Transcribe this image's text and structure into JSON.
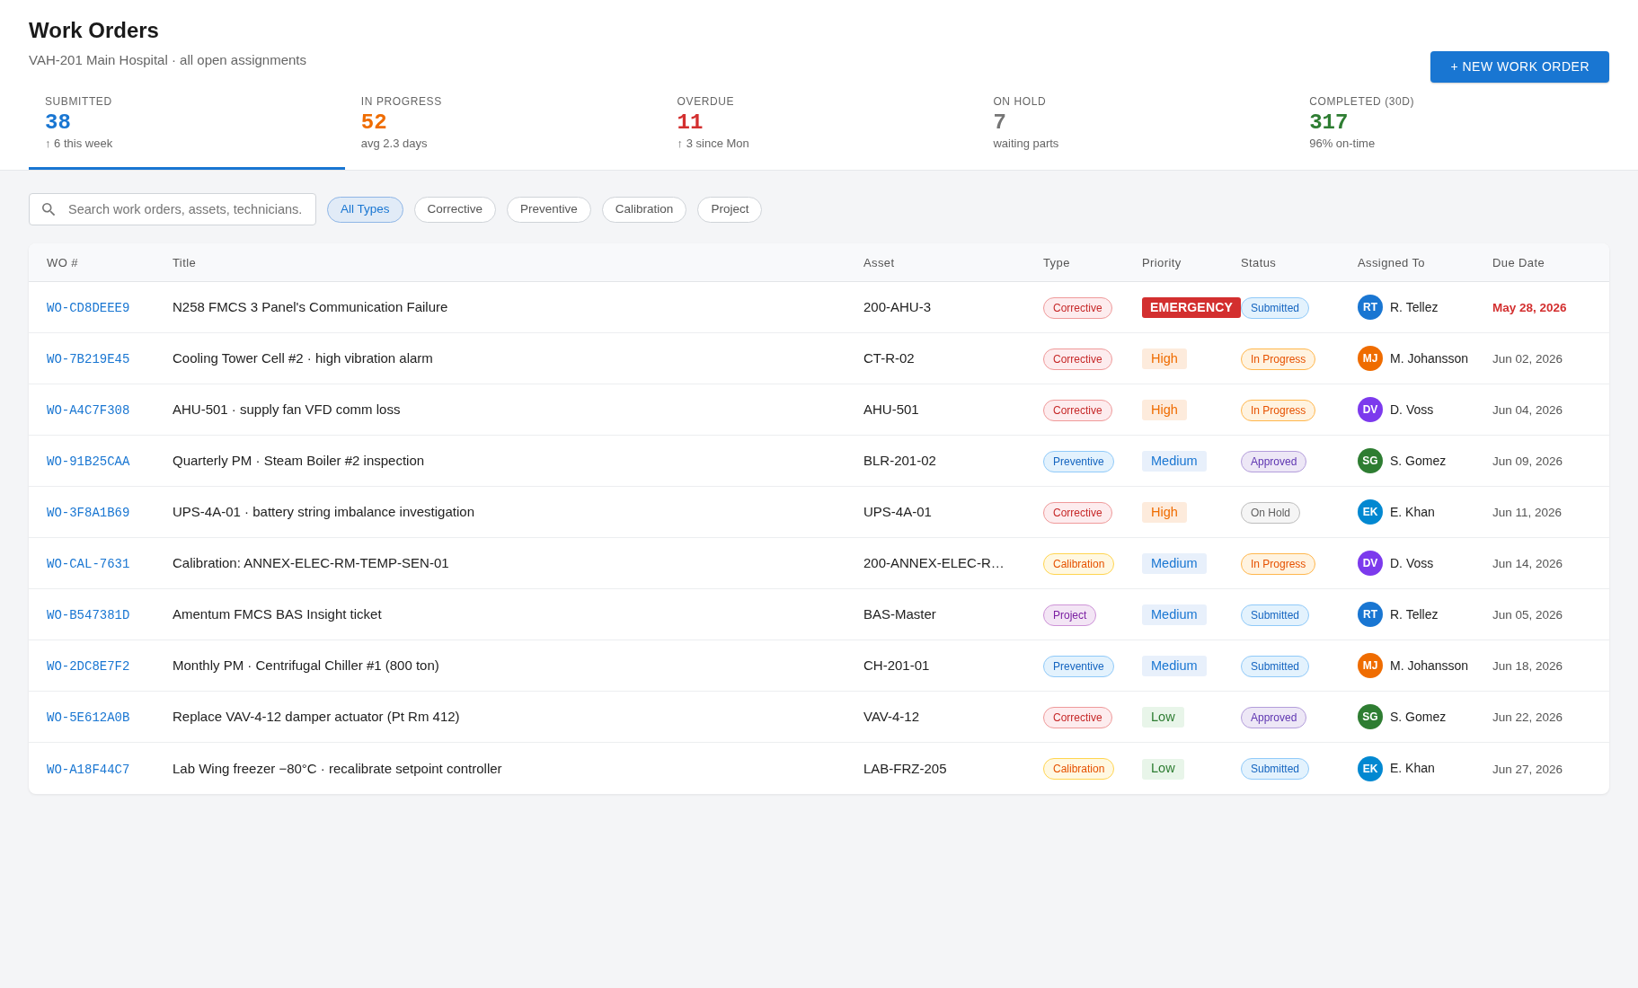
{
  "header": {
    "title": "Work Orders",
    "subtitle": "VAH-201 Main Hospital · all open assignments",
    "new_button": "+ NEW WORK ORDER"
  },
  "stats": [
    {
      "label": "SUBMITTED",
      "value": "38",
      "note": "↑ 6 this week",
      "color": "#1976d2",
      "selected": true
    },
    {
      "label": "IN PROGRESS",
      "value": "52",
      "note": "avg 2.3 days",
      "color": "#ef6c00",
      "selected": false
    },
    {
      "label": "OVERDUE",
      "value": "11",
      "note": "↑ 3 since Mon",
      "color": "#d32f2f",
      "selected": false
    },
    {
      "label": "ON HOLD",
      "value": "7",
      "note": "waiting parts",
      "color": "#757575",
      "selected": false
    },
    {
      "label": "COMPLETED (30D)",
      "value": "317",
      "note": "96% on-time",
      "color": "#2e7d32",
      "selected": false
    }
  ],
  "search": {
    "placeholder": "Search work orders, assets, technicians."
  },
  "type_filters": [
    {
      "label": "All Types",
      "selected": true
    },
    {
      "label": "Corrective",
      "selected": false
    },
    {
      "label": "Preventive",
      "selected": false
    },
    {
      "label": "Calibration",
      "selected": false
    },
    {
      "label": "Project",
      "selected": false
    }
  ],
  "table": {
    "columns": [
      "WO #",
      "Title",
      "Asset",
      "Type",
      "Priority",
      "Status",
      "Assigned To",
      "Due Date"
    ],
    "rows": [
      {
        "wo": "WO-CD8DEEE9",
        "title": "N258 FMCS 3 Panel's Communication Failure",
        "asset": "200-AHU-3",
        "type": {
          "label": "Corrective",
          "kind": "corrective"
        },
        "priority": {
          "label": "EMERGENCY",
          "kind": "emergency"
        },
        "status": {
          "label": "Submitted",
          "kind": "submitted"
        },
        "assignee": {
          "initials": "RT",
          "name": "R. Tellez",
          "color": "#1976d2"
        },
        "due": {
          "date": "May 28, 2026",
          "overdue": true
        }
      },
      {
        "wo": "WO-7B219E45",
        "title": "Cooling Tower Cell #2 · high vibration alarm",
        "asset": "CT-R-02",
        "type": {
          "label": "Corrective",
          "kind": "corrective"
        },
        "priority": {
          "label": "High",
          "kind": "high"
        },
        "status": {
          "label": "In Progress",
          "kind": "progress"
        },
        "assignee": {
          "initials": "MJ",
          "name": "M. Johansson",
          "color": "#ef6c00"
        },
        "due": {
          "date": "Jun 02, 2026",
          "overdue": false
        }
      },
      {
        "wo": "WO-A4C7F308",
        "title": "AHU-501 · supply fan VFD comm loss",
        "asset": "AHU-501",
        "type": {
          "label": "Corrective",
          "kind": "corrective"
        },
        "priority": {
          "label": "High",
          "kind": "high"
        },
        "status": {
          "label": "In Progress",
          "kind": "progress"
        },
        "assignee": {
          "initials": "DV",
          "name": "D. Voss",
          "color": "#7c3aed"
        },
        "due": {
          "date": "Jun 04, 2026",
          "overdue": false
        }
      },
      {
        "wo": "WO-91B25CAA",
        "title": "Quarterly PM · Steam Boiler #2 inspection",
        "asset": "BLR-201-02",
        "type": {
          "label": "Preventive",
          "kind": "preventive"
        },
        "priority": {
          "label": "Medium",
          "kind": "medium"
        },
        "status": {
          "label": "Approved",
          "kind": "approved"
        },
        "assignee": {
          "initials": "SG",
          "name": "S. Gomez",
          "color": "#2e7d32"
        },
        "due": {
          "date": "Jun 09, 2026",
          "overdue": false
        }
      },
      {
        "wo": "WO-3F8A1B69",
        "title": "UPS-4A-01 · battery string imbalance investigation",
        "asset": "UPS-4A-01",
        "type": {
          "label": "Corrective",
          "kind": "corrective"
        },
        "priority": {
          "label": "High",
          "kind": "high"
        },
        "status": {
          "label": "On Hold",
          "kind": "hold"
        },
        "assignee": {
          "initials": "EK",
          "name": "E. Khan",
          "color": "#0288d1"
        },
        "due": {
          "date": "Jun 11, 2026",
          "overdue": false
        }
      },
      {
        "wo": "WO-CAL-7631",
        "title": "Calibration: ANNEX-ELEC-RM-TEMP-SEN-01",
        "asset": "200-ANNEX-ELEC-R…",
        "type": {
          "label": "Calibration",
          "kind": "calibration"
        },
        "priority": {
          "label": "Medium",
          "kind": "medium"
        },
        "status": {
          "label": "In Progress",
          "kind": "progress"
        },
        "assignee": {
          "initials": "DV",
          "name": "D. Voss",
          "color": "#7c3aed"
        },
        "due": {
          "date": "Jun 14, 2026",
          "overdue": false
        }
      },
      {
        "wo": "WO-B547381D",
        "title": "Amentum FMCS BAS Insight ticket",
        "asset": "BAS-Master",
        "type": {
          "label": "Project",
          "kind": "project"
        },
        "priority": {
          "label": "Medium",
          "kind": "medium"
        },
        "status": {
          "label": "Submitted",
          "kind": "submitted"
        },
        "assignee": {
          "initials": "RT",
          "name": "R. Tellez",
          "color": "#1976d2"
        },
        "due": {
          "date": "Jun 05, 2026",
          "overdue": false
        }
      },
      {
        "wo": "WO-2DC8E7F2",
        "title": "Monthly PM · Centrifugal Chiller #1 (800 ton)",
        "asset": "CH-201-01",
        "type": {
          "label": "Preventive",
          "kind": "preventive"
        },
        "priority": {
          "label": "Medium",
          "kind": "medium"
        },
        "status": {
          "label": "Submitted",
          "kind": "submitted"
        },
        "assignee": {
          "initials": "MJ",
          "name": "M. Johansson",
          "color": "#ef6c00"
        },
        "due": {
          "date": "Jun 18, 2026",
          "overdue": false
        }
      },
      {
        "wo": "WO-5E612A0B",
        "title": "Replace VAV-4-12 damper actuator (Pt Rm 412)",
        "asset": "VAV-4-12",
        "type": {
          "label": "Corrective",
          "kind": "corrective"
        },
        "priority": {
          "label": "Low",
          "kind": "low"
        },
        "status": {
          "label": "Approved",
          "kind": "approved"
        },
        "assignee": {
          "initials": "SG",
          "name": "S. Gomez",
          "color": "#2e7d32"
        },
        "due": {
          "date": "Jun 22, 2026",
          "overdue": false
        }
      },
      {
        "wo": "WO-A18F44C7",
        "title": "Lab Wing freezer −80°C · recalibrate setpoint controller",
        "asset": "LAB-FRZ-205",
        "type": {
          "label": "Calibration",
          "kind": "calibration"
        },
        "priority": {
          "label": "Low",
          "kind": "low"
        },
        "status": {
          "label": "Submitted",
          "kind": "submitted"
        },
        "assignee": {
          "initials": "EK",
          "name": "E. Khan",
          "color": "#0288d1"
        },
        "due": {
          "date": "Jun 27, 2026",
          "overdue": false
        }
      }
    ]
  }
}
